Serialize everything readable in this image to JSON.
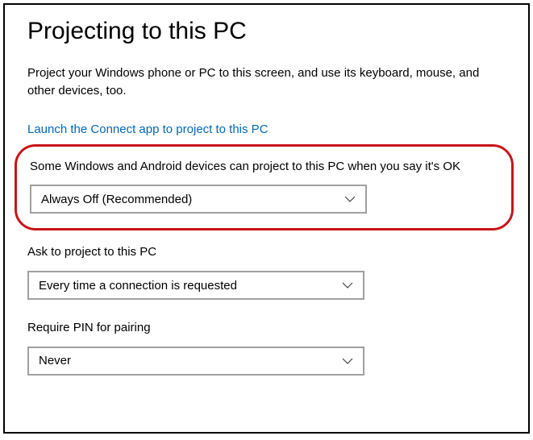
{
  "page": {
    "title": "Projecting to this PC",
    "description": "Project your Windows phone or PC to this screen, and use its keyboard, mouse, and other devices, too.",
    "link": "Launch the Connect app to project to this PC"
  },
  "settings": {
    "project_permission": {
      "label": "Some Windows and Android devices can project to this PC when you say it's OK",
      "value": "Always Off (Recommended)"
    },
    "ask_to_project": {
      "label": "Ask to project to this PC",
      "value": "Every time a connection is requested"
    },
    "require_pin": {
      "label": "Require PIN for pairing",
      "value": "Never"
    }
  }
}
